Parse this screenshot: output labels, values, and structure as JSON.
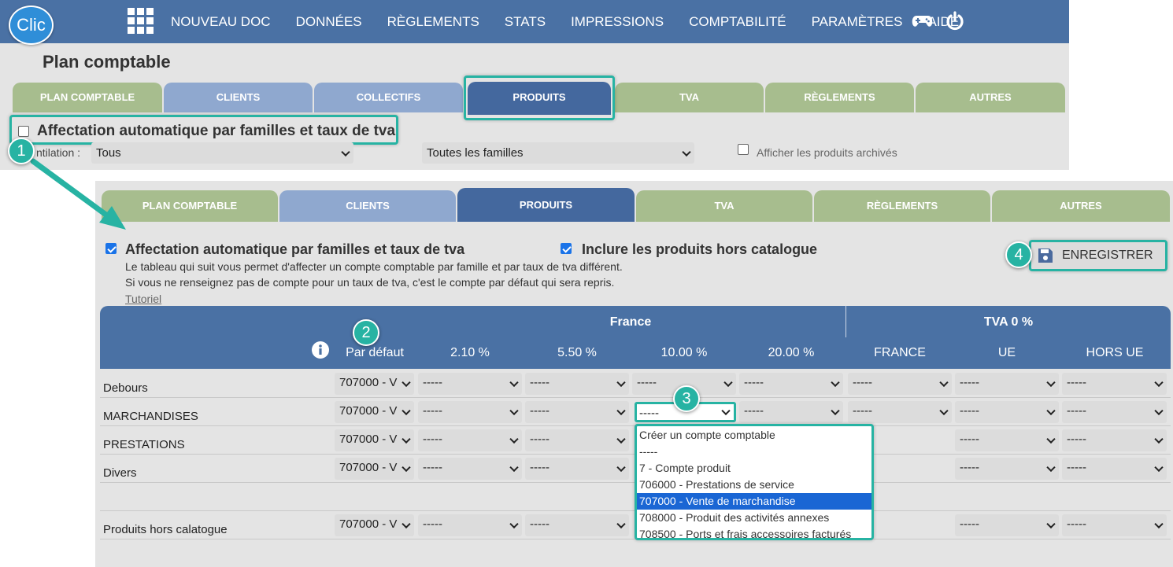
{
  "app": {
    "logo_text": "Clic"
  },
  "nav": {
    "items": [
      "NOUVEAU DOC",
      "DONNÉES",
      "RÈGLEMENTS",
      "STATS",
      "IMPRESSIONS",
      "COMPTABILITÉ",
      "PARAMÈTRES",
      "AIDE"
    ],
    "icons": [
      "apps-grid-icon",
      "gamepad-icon",
      "power-icon"
    ]
  },
  "page": {
    "title": "Plan comptable"
  },
  "top": {
    "tabs": [
      "PLAN COMPTABLE",
      "CLIENTS",
      "COLLECTIFS",
      "PRODUITS",
      "TVA",
      "RÈGLEMENTS",
      "AUTRES"
    ],
    "auto_label": "Affectation automatique par familles et taux de tva",
    "auto_checked": false,
    "ventilation_label": "ntilation :",
    "ventilation_value": "Tous",
    "familles_value": "Toutes les familles",
    "archives_label": "Afficher les produits archivés"
  },
  "bottom": {
    "tabs": [
      "PLAN COMPTABLE",
      "CLIENTS",
      "PRODUITS",
      "TVA",
      "RÈGLEMENTS",
      "AUTRES"
    ],
    "auto_label": "Affectation automatique par familles et taux de tva",
    "auto_checked": true,
    "hors_catalogue_label": "Inclure les produits hors catalogue",
    "hors_catalogue_checked": true,
    "desc_line1": "Le tableau qui suit vous permet d'affecter un compte comptable par famille et par taux de tva différent.",
    "desc_line2": "Si vous ne renseignez pas de compte pour un taux de tva, c'est le compte par défaut qui sera repris.",
    "tutorial_link": "Tutoriel",
    "save_label": "ENREGISTRER"
  },
  "table": {
    "group_france": "France",
    "group_tva0": "TVA 0 %",
    "col_default": "Par défaut",
    "rate_cols": [
      "2.10 %",
      "5.50 %",
      "10.00 %",
      "20.00 %"
    ],
    "zone_cols": [
      "FRANCE",
      "UE",
      "HORS UE"
    ],
    "rows": [
      {
        "label": "Debours",
        "default": "707000 - V"
      },
      {
        "label": "MARCHANDISES",
        "default": "707000 - V"
      },
      {
        "label": "PRESTATIONS",
        "default": "707000 - V"
      },
      {
        "label": "Divers",
        "default": "707000 - V"
      },
      {
        "label": "Produits hors calatogue",
        "default": "707000 - V"
      }
    ],
    "empty_value": "-----"
  },
  "dropdown": {
    "options": [
      "Créer un compte comptable",
      "-----",
      "7 - Compte produit",
      "706000 - Prestations de service",
      "707000 - Vente de marchandise",
      "708000 - Produit des activités annexes",
      "708500 - Ports et frais accessoires facturés"
    ],
    "selected_index": 4
  },
  "badges": [
    "1",
    "2",
    "3",
    "4"
  ],
  "colors": {
    "nav": "#4a71a4",
    "tab_active": "#44689e",
    "tab_green": "#a7bd8e",
    "tab_blue": "#8fa8cf",
    "highlight": "#27b3a3",
    "selected": "#1a66d4"
  }
}
